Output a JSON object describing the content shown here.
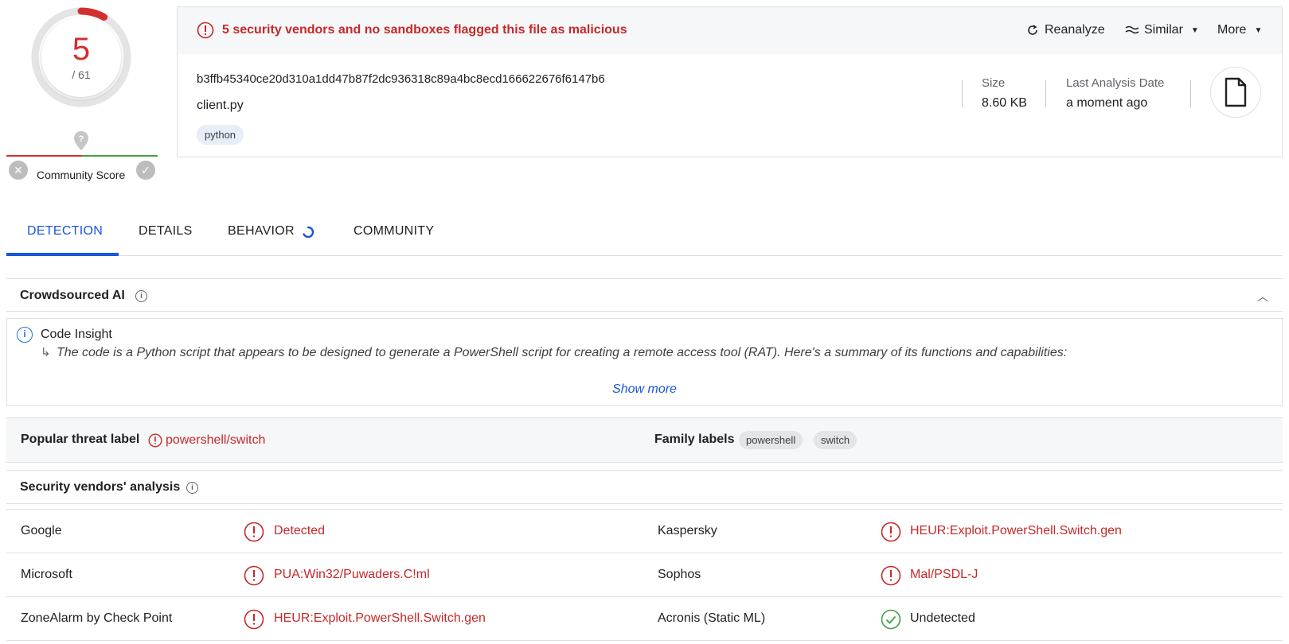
{
  "score": {
    "detections": "5",
    "total": "/ 61",
    "fraction": 0.082,
    "color": "#d32f2f"
  },
  "community": {
    "label": "Community Score"
  },
  "alert": {
    "text": "5 security vendors and no sandboxes flagged this file as malicious",
    "color": "#c62828"
  },
  "actions": {
    "reanalyze": "Reanalyze",
    "similar": "Similar",
    "more": "More"
  },
  "file": {
    "hash": "b3ffb45340ce20d310a1dd47b87f2dc936318c89a4bc8ecd166622676f6147b6",
    "name": "client.py",
    "tag": "python",
    "size_label": "Size",
    "size_value": "8.60 KB",
    "date_label": "Last Analysis Date",
    "date_value": "a moment ago",
    "icon": "file-icon"
  },
  "tabs": [
    {
      "label": "DETECTION",
      "active": true
    },
    {
      "label": "DETAILS",
      "active": false
    },
    {
      "label": "BEHAVIOR",
      "active": false
    },
    {
      "label": "COMMUNITY",
      "active": false
    }
  ],
  "crowdsourced": {
    "title": "Crowdsourced AI",
    "code_insight_title": "Code Insight",
    "summary": "The code is a Python script that appears to be designed to generate a PowerShell script for creating a remote access tool (RAT). Here's a summary of its functions and capabilities:",
    "show_more": "Show more"
  },
  "labels": {
    "popular_title": "Popular threat label",
    "popular_value": "powershell/switch",
    "family_title": "Family labels",
    "family": [
      "powershell",
      "switch"
    ]
  },
  "vendors": {
    "title": "Security vendors' analysis",
    "rows": [
      [
        {
          "name": "Google",
          "result": "Detected",
          "status": "detected"
        },
        {
          "name": "Kaspersky",
          "result": "HEUR:Exploit.PowerShell.Switch.gen",
          "status": "detected"
        }
      ],
      [
        {
          "name": "Microsoft",
          "result": "PUA:Win32/Puwaders.C!ml",
          "status": "detected"
        },
        {
          "name": "Sophos",
          "result": "Mal/PSDL-J",
          "status": "detected"
        }
      ],
      [
        {
          "name": "ZoneAlarm by Check Point",
          "result": "HEUR:Exploit.PowerShell.Switch.gen",
          "status": "detected"
        },
        {
          "name": "Acronis (Static ML)",
          "result": "Undetected",
          "status": "undetected"
        }
      ]
    ]
  },
  "colors": {
    "accent": "#1a56db",
    "danger": "#c62828",
    "success": "#43a047"
  }
}
